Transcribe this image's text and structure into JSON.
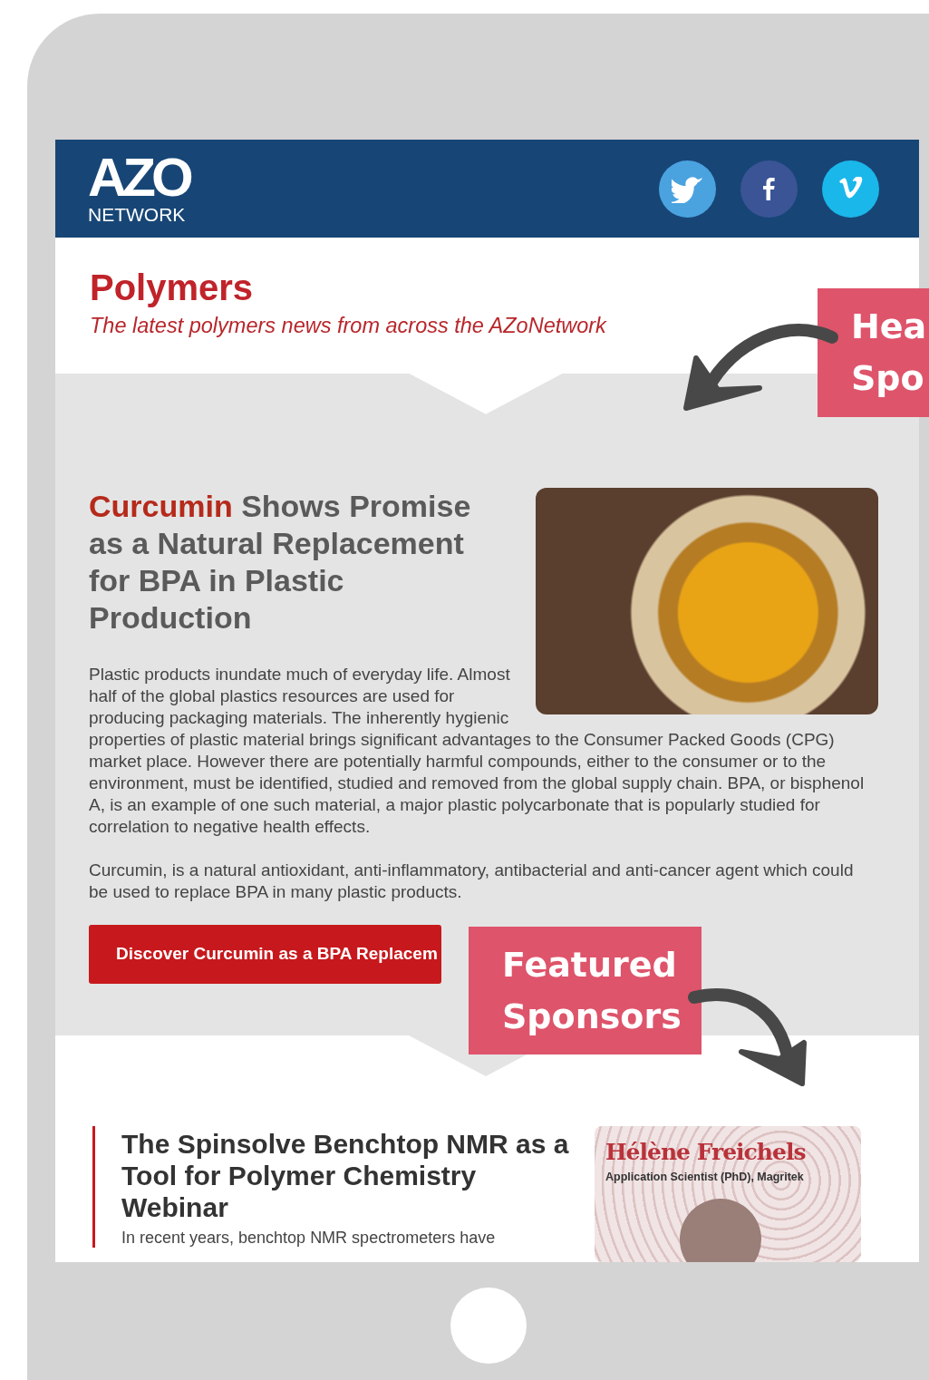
{
  "header": {
    "logo": {
      "wordmark": "AZO",
      "tagline": "NETWORK"
    },
    "social_links": [
      {
        "kind": "twitter"
      },
      {
        "kind": "facebook"
      },
      {
        "kind": "vimeo"
      }
    ]
  },
  "newsletter": {
    "title": "Polymers",
    "subtitle": "The latest polymers news from across the AZoNetwork"
  },
  "article": {
    "headline": [
      {
        "text": "Curcumin",
        "highlight": true
      },
      {
        "text": "Shows Promise as a Natural Replacement for BPA in Plastic Production",
        "highlight": false
      }
    ],
    "paragraphs": [
      "Plastic products inundate much of everyday life. Almost half of the global plastics resources are used for producing packaging materials. The inherently hygienic properties of plastic material brings significant advantages to the Consumer Packed Goods (CPG) market place. However there are potentially harmful compounds, either to the consumer or to the environment, must be identified, studied and removed from the global supply chain. BPA, or bisphenol A, is an example of one such material, a major plastic polycarbonate that is popularly studied for correlation to negative health effects.",
      "Curcumin, is a natural antioxidant, anti-inflammatory, antibacterial and anti-cancer agent which could be used to replace BPA in many plastic products."
    ],
    "button": "Discover Curcumin as a BPA Replacem"
  },
  "webinar": {
    "title": "The Spinsolve Benchtop NMR as a Tool for Polymer Chemistry Webinar",
    "excerpt": "In recent years, benchtop NMR spectrometers have",
    "speaker_card": {
      "name": "Hélène Freichels",
      "role": "Application Scientist (PhD), Magritek"
    }
  },
  "callouts": [
    {
      "kind": "header",
      "lines": [
        "Hea",
        "Spo"
      ]
    },
    {
      "kind": "featured",
      "lines": [
        "Featured",
        "Sponsors"
      ]
    }
  ]
}
